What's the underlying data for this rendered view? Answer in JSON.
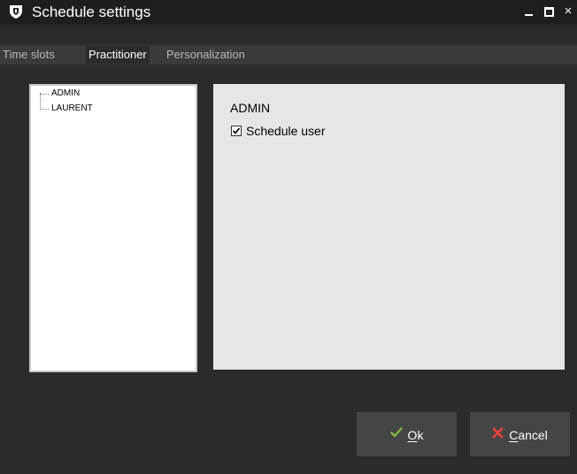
{
  "window": {
    "title": "Schedule settings",
    "controls": {
      "minimize": "minimize-icon",
      "maximize": "maximize-icon",
      "close": "×"
    }
  },
  "tabs": [
    {
      "label": "Time slots",
      "active": false
    },
    {
      "label": "Practitioner",
      "active": true
    },
    {
      "label": "Personalization",
      "active": false
    }
  ],
  "tree": {
    "items": [
      {
        "label": "ADMIN"
      },
      {
        "label": "LAURENT"
      }
    ]
  },
  "details": {
    "user_name": "ADMIN",
    "schedule_user_label": "Schedule user",
    "schedule_user_checked": true
  },
  "buttons": {
    "ok": {
      "mnemonic": "O",
      "rest": "k"
    },
    "cancel": {
      "mnemonic": "C",
      "rest": "ancel"
    }
  },
  "colors": {
    "ok_icon": "#7fb93d",
    "cancel_icon": "#e6413a"
  },
  "icons": {
    "app": "app-shield-icon",
    "ok": "checkmark-icon",
    "cancel": "x-icon"
  }
}
